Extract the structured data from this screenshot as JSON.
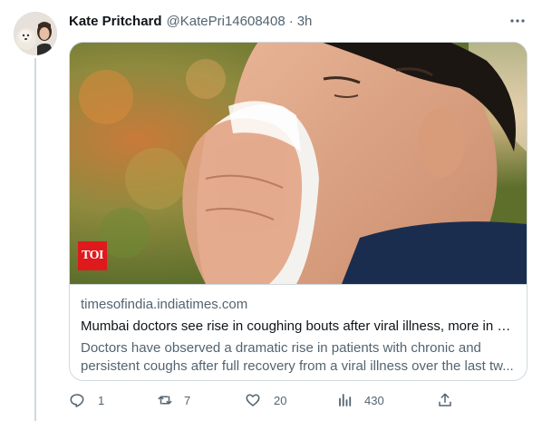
{
  "tweet": {
    "author_name": "Kate Pritchard",
    "author_handle": "@KatePri14608408",
    "separator": "·",
    "timestamp": "3h",
    "avatar_icon": "profile-photo-with-dog"
  },
  "card": {
    "image_badge": "TOI",
    "badge_color": "#e0191d",
    "domain": "timesofindia.indiatimes.com",
    "title": "Mumbai doctors see rise in coughing bouts after viral illness, more in ki...",
    "description": "Doctors have observed a dramatic rise in patients with chronic and persistent coughs after full recovery from a viral illness over the last tw..."
  },
  "actions": {
    "reply_count": "1",
    "retweet_count": "7",
    "like_count": "20",
    "views_count": "430"
  },
  "colors": {
    "secondary_text": "#536471",
    "border": "#cfd9de"
  }
}
